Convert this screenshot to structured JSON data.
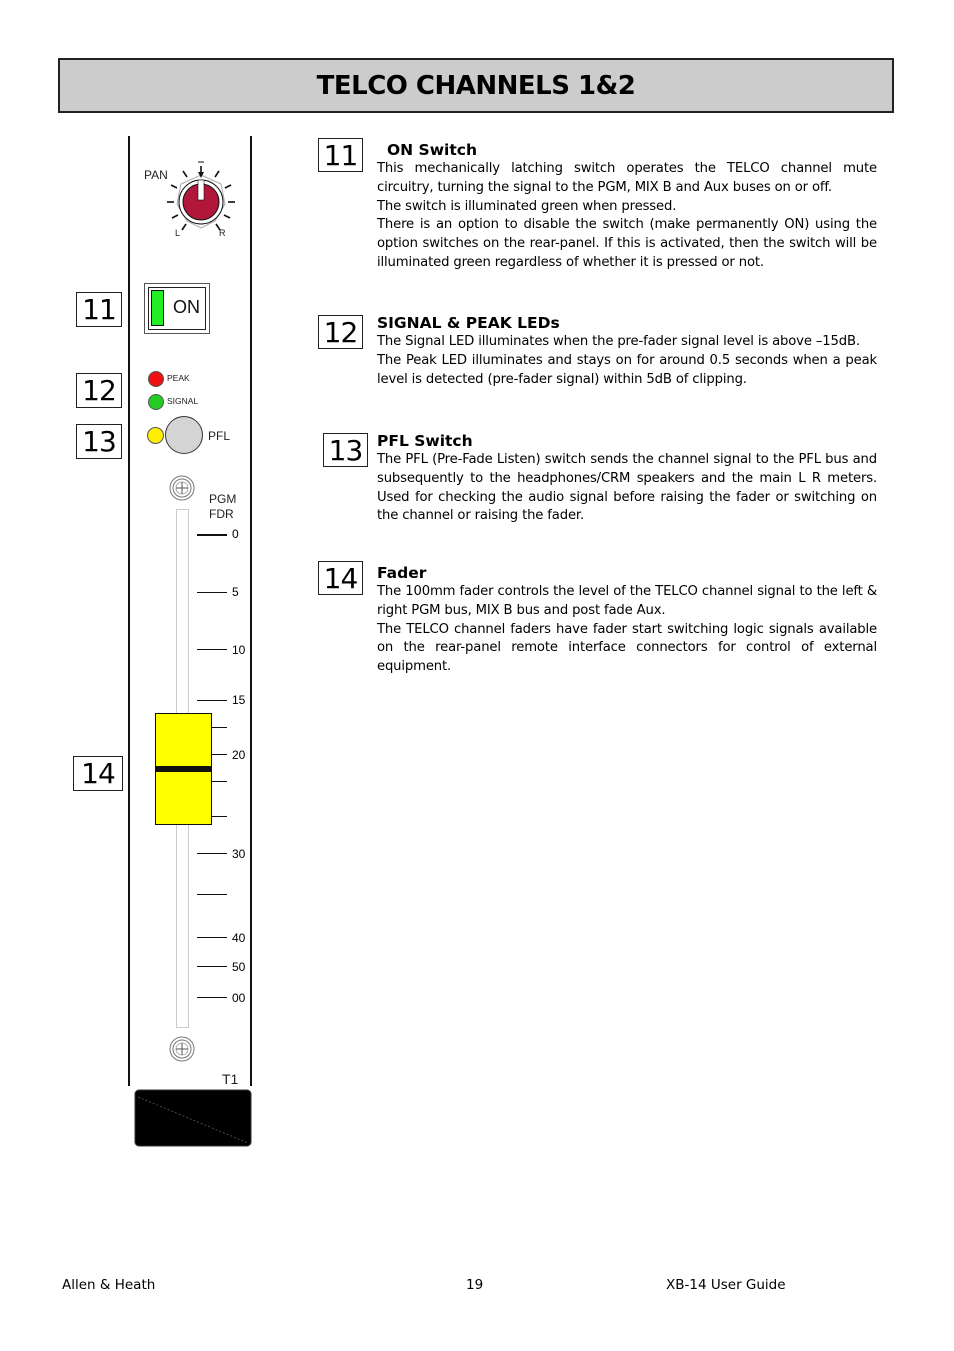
{
  "header": {
    "title": "TELCO CHANNELS 1&2"
  },
  "callouts_left": [
    "11",
    "12",
    "13",
    "14"
  ],
  "channel_strip": {
    "pan_label": "PAN",
    "pan_left": "L",
    "pan_right": "R",
    "on_switch_label": "ON",
    "peak_label": "PEAK",
    "signal_label": "SIGNAL",
    "pfl_label": "PFL",
    "fader_label_line1": "PGM",
    "fader_label_line2": "FDR",
    "fader_scale": [
      "0",
      "5",
      "10",
      "15",
      "20",
      "30",
      "40",
      "50",
      "00"
    ],
    "channel_id": "T1",
    "colors": {
      "pan_knob": "#b0173a",
      "on_led": "#22ee22",
      "peak_led": "#ee1111",
      "signal_led": "#22cc22",
      "pfl_led": "#ffee00",
      "fader_cap": "#ffff00"
    }
  },
  "sections": [
    {
      "number": "11",
      "heading": "ON Switch",
      "paragraphs": [
        "This mechanically latching switch operates the TELCO channel mute circuitry, turning the signal to the PGM, MIX B and Aux buses on or off.",
        "The switch is illuminated green when pressed.",
        "There is an option to disable the switch (make permanently ON) using the option switches on the rear-panel. If this is activated, then the switch will be illuminated green regardless of whether it is pressed or not."
      ]
    },
    {
      "number": "12",
      "heading": "SIGNAL & PEAK LEDs",
      "paragraphs": [
        "The Signal LED illuminates when the pre-fader signal level is above –15dB.",
        "The Peak LED illuminates and stays on for around 0.5 seconds when a peak level is detected (pre-fader signal) within 5dB of clipping."
      ]
    },
    {
      "number": "13",
      "heading": "PFL Switch",
      "paragraphs": [
        "The PFL (Pre-Fade Listen) switch sends the channel signal to the PFL bus and subsequently to the headphones/CRM speakers and the main L R meters. Used for checking the audio signal before raising the fader or switching on the channel or raising the fader."
      ]
    },
    {
      "number": "14",
      "heading": "Fader",
      "paragraphs": [
        "The 100mm fader controls the level of the TELCO channel signal to the left & right PGM bus, MIX B bus and post fade Aux.",
        "The TELCO channel faders have fader start switching logic signals available on the rear-panel remote interface connectors for control of external equipment."
      ]
    }
  ],
  "footer": {
    "left": "Allen & Heath",
    "center": "19",
    "right": "XB-14 User Guide"
  }
}
